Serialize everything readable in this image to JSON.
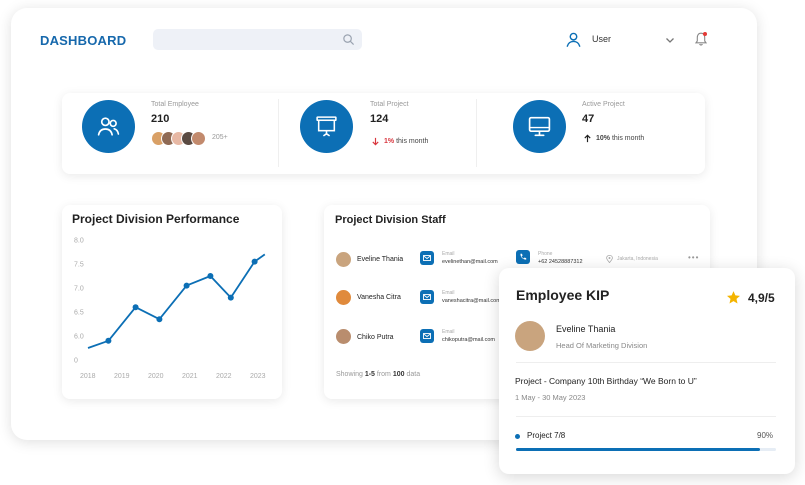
{
  "header": {
    "title": "DASHBOARD",
    "search_placeholder": "",
    "user_label": "User"
  },
  "stats": [
    {
      "label": "Total Employee",
      "value": "210",
      "sub_extra": "205+"
    },
    {
      "label": "Total Project",
      "value": "124",
      "change": "1%",
      "change_text": "this month",
      "direction": "down",
      "change_color": "#d9363e"
    },
    {
      "label": "Active Project",
      "value": "47",
      "change": "10%",
      "change_text": "this month",
      "direction": "up",
      "change_color": "#222222"
    }
  ],
  "performance": {
    "title": "Project Division Performance"
  },
  "chart_data": {
    "type": "line",
    "title": "Project Division Performance",
    "x_ticks": [
      "2018",
      "2019",
      "2020",
      "2021",
      "2022",
      "2023"
    ],
    "y_ticks": [
      "0",
      "6.0",
      "6.5",
      "7.0",
      "7.5",
      "8.0"
    ],
    "ylim": [
      5.5,
      8.0
    ],
    "series": [
      {
        "color": "#0c6fb5",
        "points": [
          {
            "x": 2018.0,
            "y": 5.75
          },
          {
            "x": 2018.6,
            "y": 5.9
          },
          {
            "x": 2019.4,
            "y": 6.6
          },
          {
            "x": 2020.1,
            "y": 6.35
          },
          {
            "x": 2020.9,
            "y": 7.05
          },
          {
            "x": 2021.6,
            "y": 7.25
          },
          {
            "x": 2022.2,
            "y": 6.8
          },
          {
            "x": 2022.9,
            "y": 7.55
          },
          {
            "x": 2023.2,
            "y": 7.7
          }
        ]
      }
    ],
    "grid": false
  },
  "staff": {
    "title": "Project Division Staff",
    "rows": [
      {
        "name": "Eveline Thania",
        "email_label": "Email",
        "email": "evelinethan@mail.com",
        "phone_label": "Phone",
        "phone": "+62 24528887312",
        "location": "Jakarta, Indonesia",
        "avatar_color": "#c9a47e"
      },
      {
        "name": "Vanesha Citra",
        "email_label": "Email",
        "email": "vaneshacitra@mail.com",
        "avatar_color": "#e08a3c"
      },
      {
        "name": "Chiko Putra",
        "email_label": "Email",
        "email": "chikoputra@mail.com",
        "avatar_color": "#b98d6e"
      }
    ],
    "showing_prefix": "Showing",
    "showing_range": "1-5",
    "showing_mid": "from",
    "showing_total": "100",
    "showing_suffix": "data"
  },
  "kip": {
    "title": "Employee KIP",
    "rating": "4,9/5",
    "name": "Eveline Thania",
    "role": "Head Of Marketing Division",
    "project": "Project - Company 10th Birthday “We Born to U”",
    "date": "1 May - 30 May 2023",
    "progress_label": "Project 7/8",
    "progress_pct": "90%",
    "progress_value": 0.94
  },
  "colors": {
    "accent": "#0c6fb5",
    "title_blue": "#1668ac",
    "star": "#f4b400"
  }
}
